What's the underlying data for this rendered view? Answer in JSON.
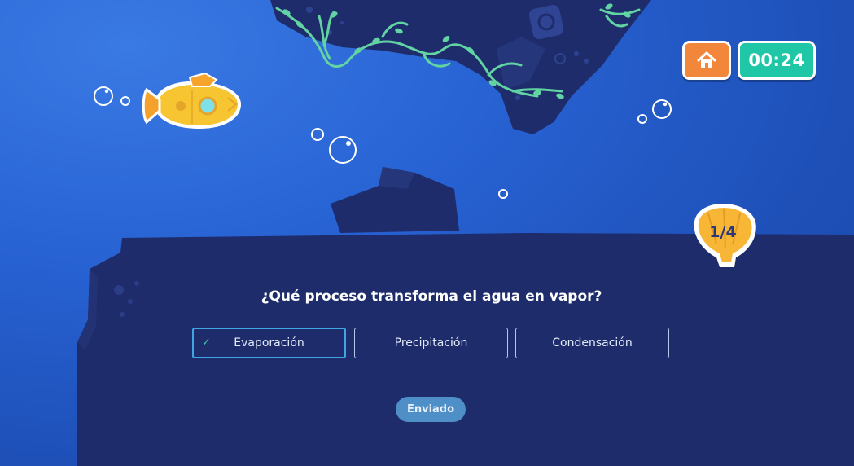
{
  "hud": {
    "home_icon": "home-icon",
    "timer": "00:24"
  },
  "progress": {
    "label": "1/4",
    "icon": "shell-icon"
  },
  "quiz": {
    "question": "¿Qué proceso transforma el agua en vapor?",
    "options": [
      "Evaporación",
      "Precipitación",
      "Condensación"
    ],
    "selected_index": 0,
    "submit_label": "Enviado"
  },
  "colors": {
    "water": "#2863d4",
    "rock": "#1e2c6b",
    "home_button": "#f2863a",
    "timer_button": "#1fc7a6",
    "submarine": "#f7c531",
    "vine": "#62d3a3",
    "selected_border": "#3fa6e2",
    "submit": "#4e8fc8"
  }
}
